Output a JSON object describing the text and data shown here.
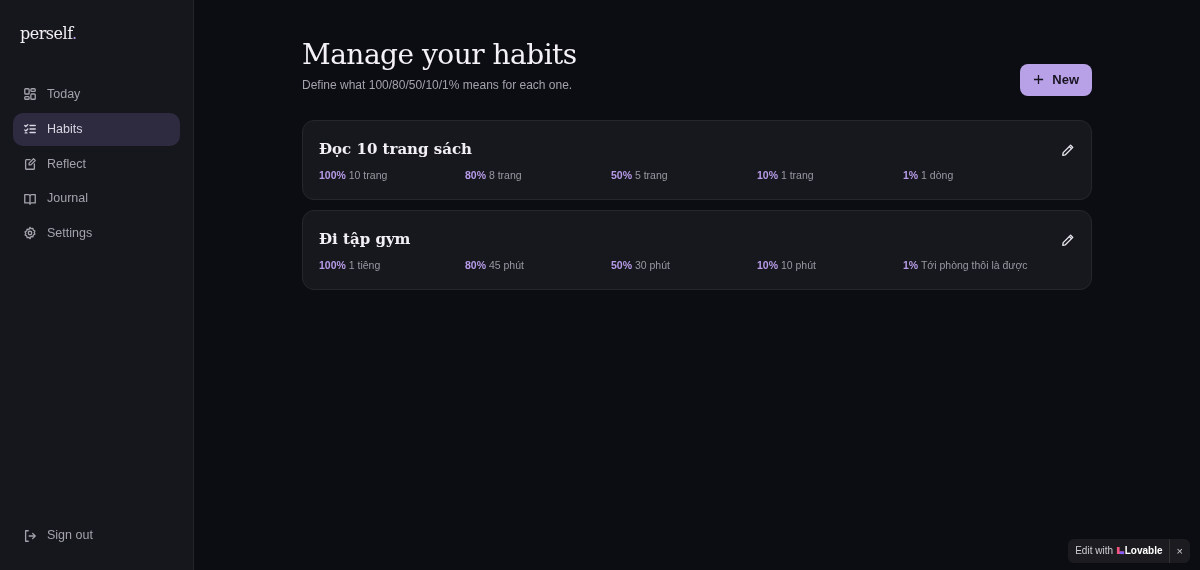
{
  "brand": {
    "name": "perself",
    "dot": "."
  },
  "sidebar": {
    "items": [
      {
        "label": "Today",
        "selected": false
      },
      {
        "label": "Habits",
        "selected": true
      },
      {
        "label": "Reflect",
        "selected": false
      },
      {
        "label": "Journal",
        "selected": false
      },
      {
        "label": "Settings",
        "selected": false
      }
    ],
    "sign_out": "Sign out"
  },
  "header": {
    "title": "Manage your habits",
    "subtitle": "Define what 100/80/50/10/1% means for each one.",
    "new_button": "New"
  },
  "habits": [
    {
      "name": "Đọc 10 trang sách",
      "levels": [
        {
          "percent": "100%",
          "text": "10 trang"
        },
        {
          "percent": "80%",
          "text": "8 trang"
        },
        {
          "percent": "50%",
          "text": "5 trang"
        },
        {
          "percent": "10%",
          "text": "1 trang"
        },
        {
          "percent": "1%",
          "text": "1 dòng"
        }
      ]
    },
    {
      "name": "Đi tập gym",
      "levels": [
        {
          "percent": "100%",
          "text": "1 tiêng"
        },
        {
          "percent": "80%",
          "text": "45 phút"
        },
        {
          "percent": "50%",
          "text": "30 phút"
        },
        {
          "percent": "10%",
          "text": "10 phút"
        },
        {
          "percent": "1%",
          "text": "Tới phòng thôi là được"
        }
      ]
    }
  ],
  "badge": {
    "text": "Edit with",
    "brand": "Lovable",
    "close": "×"
  }
}
